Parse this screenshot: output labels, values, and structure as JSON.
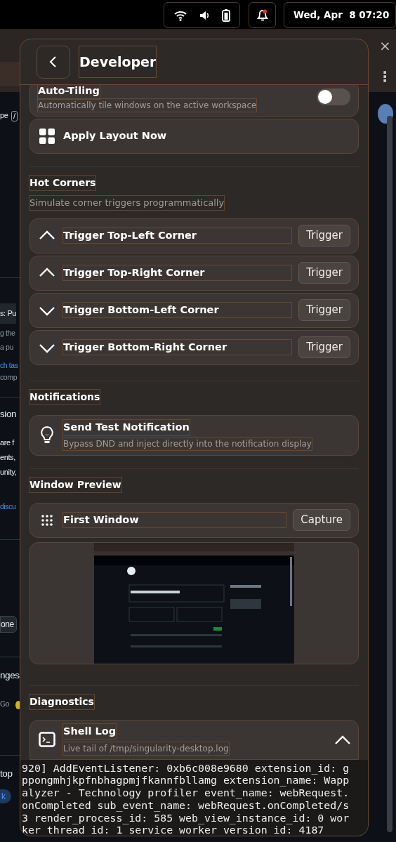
{
  "top_bar": {
    "clock": "Wed, Apr  8 07:20",
    "notification_dot": true
  },
  "background_page": {
    "close": "×",
    "menu": "⋮",
    "fragments": [
      {
        "text": "pe",
        "kind": "text"
      },
      {
        "text": "/",
        "kind": "key"
      },
      {
        "text": "s: Pu",
        "kind": "bar"
      },
      {
        "text": "g the",
        "kind": "muted"
      },
      {
        "text": "a pu",
        "kind": "muted"
      },
      {
        "text": "ch tas",
        "kind": "link"
      },
      {
        "text": "comp",
        "kind": "muted"
      },
      {
        "text": "sion",
        "kind": "heading"
      },
      {
        "text": "are f",
        "kind": "text"
      },
      {
        "text": "ents,",
        "kind": "text"
      },
      {
        "text": "unity,",
        "kind": "text"
      },
      {
        "text": "discu",
        "kind": "link"
      },
      {
        "text": "one",
        "kind": "button"
      },
      {
        "text": "nges",
        "kind": "heading"
      },
      {
        "text": "Go",
        "kind": "muted"
      },
      {
        "text": "top",
        "kind": "heading"
      },
      {
        "text": "k",
        "kind": "pill"
      }
    ]
  },
  "panel": {
    "title": "Developer",
    "auto_tiling": {
      "label": "Auto-Tiling",
      "description": "Automatically tile windows on the active workspace",
      "on": false
    },
    "apply_layout": {
      "label": "Apply Layout Now"
    },
    "sections": [
      {
        "kind": "corners",
        "title": "Hot Corners",
        "subtitle": "Simulate corner triggers programmatically",
        "rows": [
          {
            "kind": "top",
            "label": "Trigger Top-Left Corner",
            "button": "Trigger"
          },
          {
            "kind": "top",
            "label": "Trigger Top-Right Corner",
            "button": "Trigger"
          },
          {
            "kind": "bottom",
            "label": "Trigger Bottom-Left Corner",
            "button": "Trigger"
          },
          {
            "kind": "bottom",
            "label": "Trigger Bottom-Right Corner",
            "button": "Trigger"
          }
        ]
      },
      {
        "kind": "notifications",
        "title": "Notifications",
        "label": "Send Test Notification",
        "description": "Bypass DND and inject directly into the notification display"
      },
      {
        "kind": "preview",
        "title": "Window Preview",
        "label": "First Window",
        "button": "Capture"
      },
      {
        "kind": "diagnostics",
        "title": "Diagnostics",
        "label": "Shell Log",
        "description": "Live tail of /tmp/singularity-desktop.log",
        "expanded": true,
        "log_lines": [
          "920] AddEventListener: 0xb6c008e9680 extension_id: g",
          "ppongmhjkpfnbhagpmjfkannfbllamg extension_name: Wapp",
          "alyzer - Technology profiler event_name: webRequest.",
          "onCompleted sub_event_name: webRequest.onCompleted/s",
          "3 render_process_id: 585 web_view_instance_id: 0 wor",
          "ker thread id: 1 service worker version id: 4187"
        ]
      }
    ]
  }
}
